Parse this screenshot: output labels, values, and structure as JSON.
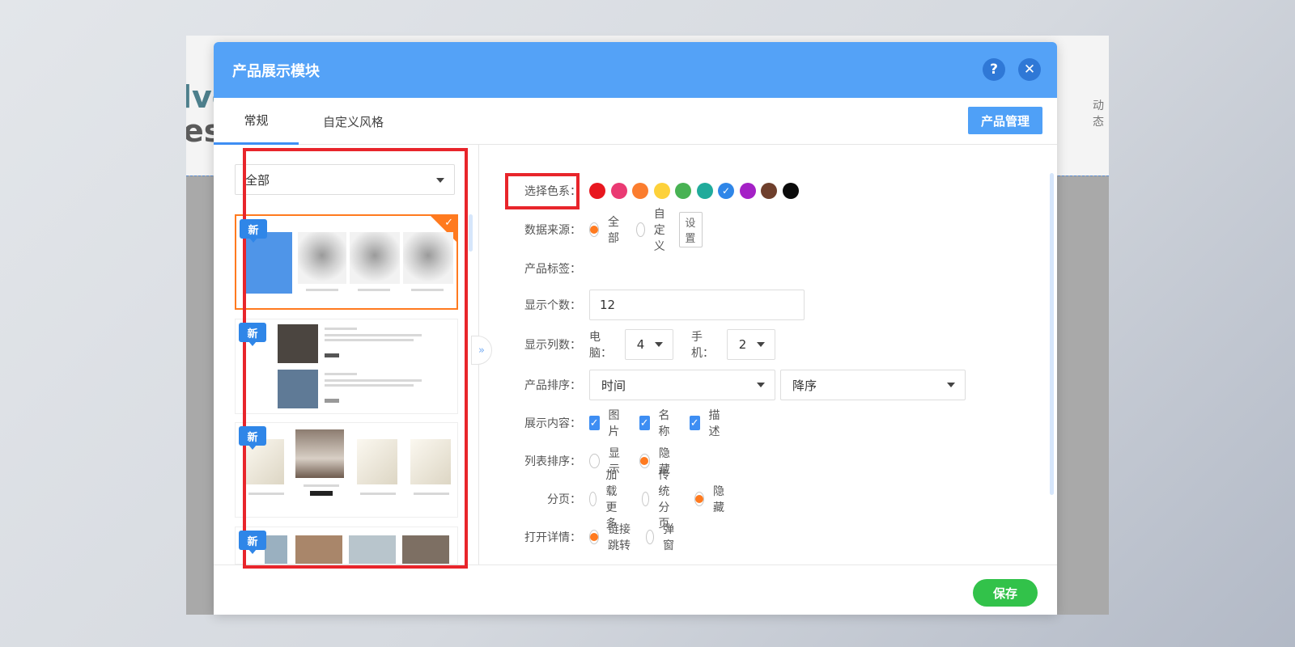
{
  "background": {
    "title_fragment_1": "lve",
    "title_fragment_2": "esi",
    "right_fragment": "动态"
  },
  "dialog": {
    "title": "产品展示模块",
    "help_icon": "?",
    "close_icon": "✕"
  },
  "tabs": {
    "general": "常规",
    "custom_style": "自定义风格",
    "product_management": "产品管理"
  },
  "template_panel": {
    "category_value": "全部",
    "new_badge": "新",
    "selected_check": "✓",
    "collapse_icon": "»"
  },
  "colors": {
    "header": "#54a2f7",
    "accent": "#3e8ef3",
    "radio_active": "#ff7a1f",
    "save": "#32c24a",
    "highlight": "#e8252b",
    "swatches": [
      "#e8171f",
      "#ea3a73",
      "#fb7d2f",
      "#fdd13a",
      "#48b253",
      "#20ab9b",
      "#2f86e8",
      "#a421c6",
      "#6e3f2c",
      "#0a0a0a"
    ],
    "selected_swatch_index": 6
  },
  "settings": {
    "color_label": "选择色系：",
    "data_source_label": "数据来源：",
    "data_source_options": [
      "全部",
      "自定义"
    ],
    "data_source_selected": "全部",
    "data_source_settings_btn": "设置",
    "product_tag_label": "产品标签：",
    "display_count_label": "显示个数：",
    "display_count_value": "12",
    "columns_label": "显示列数：",
    "pc_label": "电脑：",
    "pc_columns": "4",
    "mobile_label": "手机：",
    "mobile_columns": "2",
    "sort_label": "产品排序：",
    "sort_field": "时间",
    "sort_order": "降序",
    "content_label": "展示内容：",
    "content_options": [
      "图片",
      "名称",
      "描述"
    ],
    "list_sort_label": "列表排序：",
    "list_sort_options": [
      "显示",
      "隐藏"
    ],
    "list_sort_selected": "隐藏",
    "paging_label": "分页：",
    "paging_options": [
      "加载更多",
      "传统分页",
      "隐藏"
    ],
    "paging_selected": "隐藏",
    "open_detail_label": "打开详情：",
    "open_detail_options": [
      "链接跳转",
      "弹窗"
    ],
    "open_detail_selected": "链接跳转"
  },
  "footer": {
    "save": "保存"
  }
}
